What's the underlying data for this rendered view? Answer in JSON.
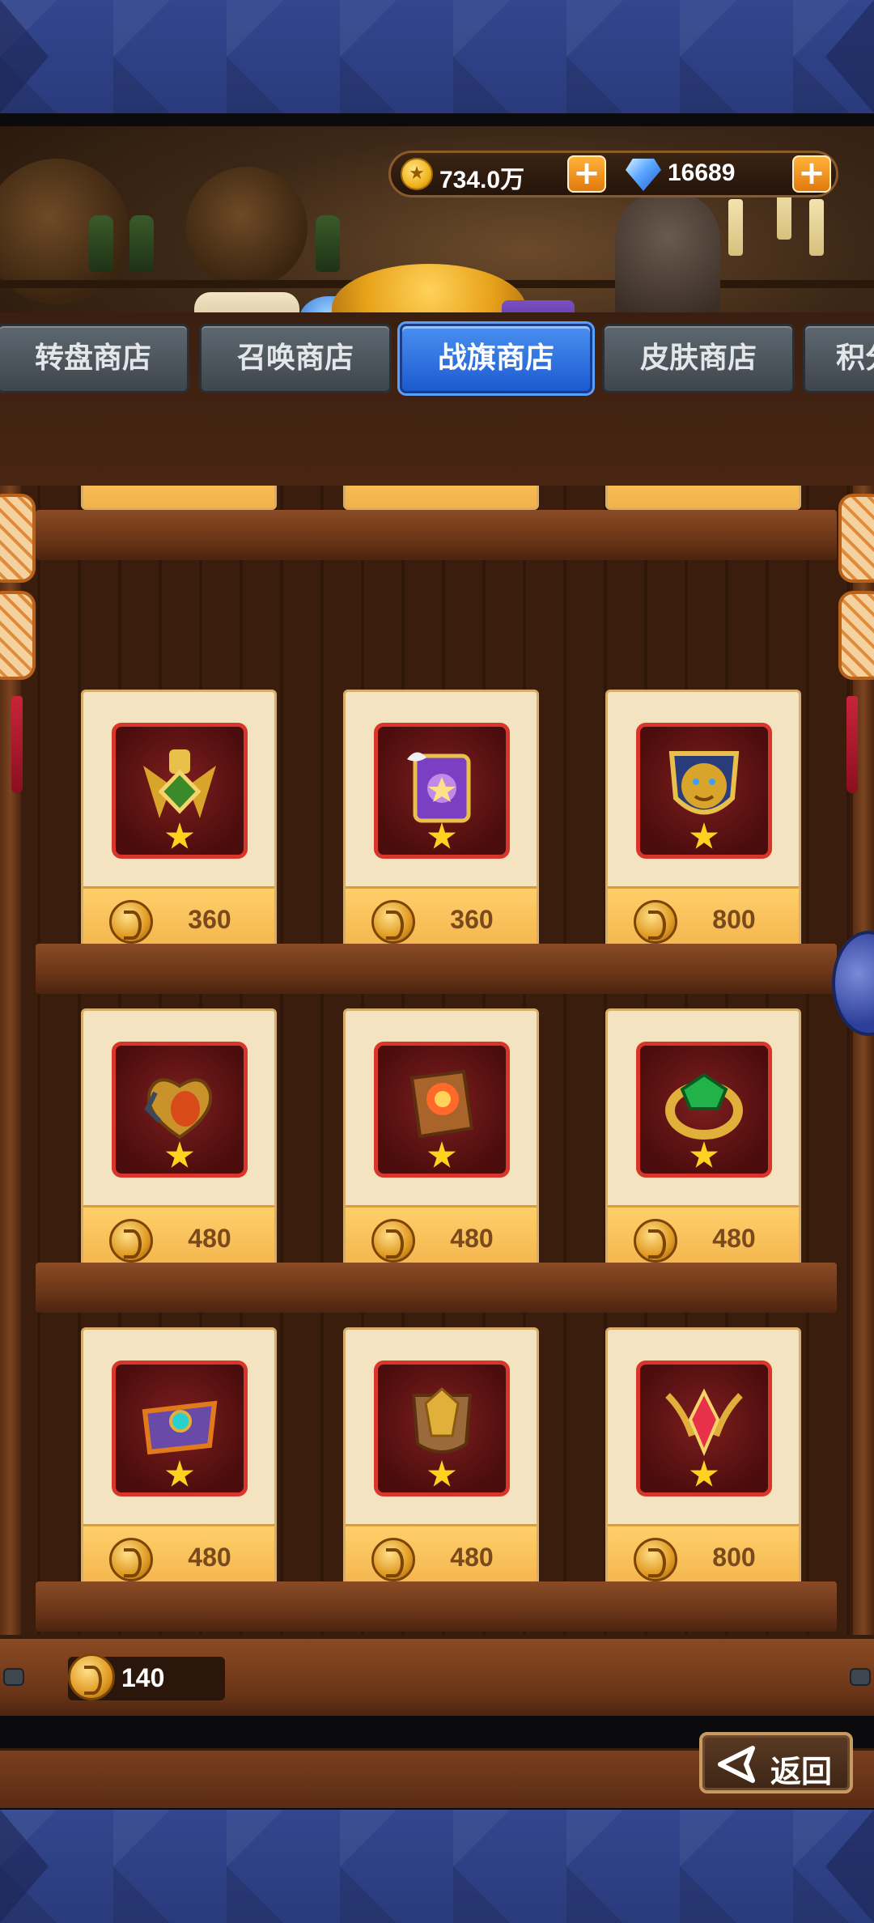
{
  "currency": {
    "gold": "734.0万",
    "diamonds": "16689"
  },
  "tabs": [
    {
      "label": "转盘商店",
      "active": false
    },
    {
      "label": "召唤商店",
      "active": false
    },
    {
      "label": "战旗商店",
      "active": true
    },
    {
      "label": "皮肤商店",
      "active": false
    },
    {
      "label": "积分",
      "active": false
    }
  ],
  "items": [
    {
      "name": "golden-wing-medal",
      "price": "360",
      "icon": "medal-icon"
    },
    {
      "name": "purple-spellbook",
      "price": "360",
      "icon": "book-icon"
    },
    {
      "name": "lion-shield",
      "price": "800",
      "icon": "lion-shield-icon"
    },
    {
      "name": "mechanical-heart",
      "price": "480",
      "icon": "heart-icon"
    },
    {
      "name": "fire-tome",
      "price": "480",
      "icon": "tome-icon"
    },
    {
      "name": "emerald-ring",
      "price": "480",
      "icon": "ring-icon"
    },
    {
      "name": "jeweled-chest",
      "price": "480",
      "icon": "chest-icon"
    },
    {
      "name": "golden-gauntlet-crest",
      "price": "480",
      "icon": "crest-icon"
    },
    {
      "name": "ruby-antler-emblem",
      "price": "800",
      "icon": "emblem-icon"
    }
  ],
  "balance": "140",
  "back_button": "返回",
  "colors": {
    "active_tab": "#2a6ee0",
    "card_bg": "#f4e3c0",
    "price_bar": "#f7bb54",
    "price_text": "#7a4a1c"
  }
}
